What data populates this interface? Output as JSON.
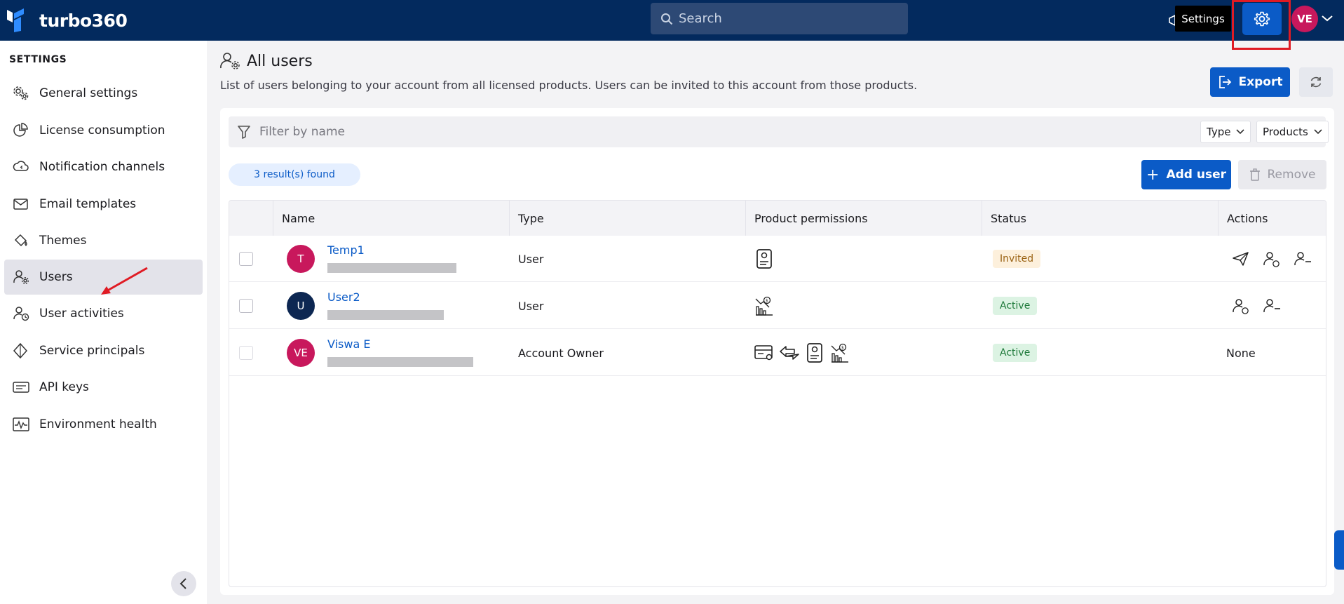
{
  "header": {
    "logo_text": "turbo360",
    "search_placeholder": "Search",
    "tooltip": "Settings",
    "avatar_initials": "VE"
  },
  "sidebar": {
    "heading": "SETTINGS",
    "items": [
      {
        "label": "General settings",
        "icon": "gears-icon"
      },
      {
        "label": "License consumption",
        "icon": "pie-chart-icon"
      },
      {
        "label": "Notification channels",
        "icon": "cloud-bell-icon"
      },
      {
        "label": "Email templates",
        "icon": "envelope-icon"
      },
      {
        "label": "Themes",
        "icon": "paint-bucket-icon"
      },
      {
        "label": "Users",
        "icon": "user-gear-icon",
        "active": true
      },
      {
        "label": "User activities",
        "icon": "user-clock-icon"
      },
      {
        "label": "Service principals",
        "icon": "diamond-icon"
      },
      {
        "label": "API keys",
        "icon": "api-key-icon"
      },
      {
        "label": "Environment health",
        "icon": "pulse-icon"
      }
    ]
  },
  "page": {
    "title": "All users",
    "description": "List of users belonging to your account from all licensed products. Users can be invited to this account from those products.",
    "export_label": "Export"
  },
  "filters": {
    "placeholder": "Filter by name",
    "type_label": "Type",
    "products_label": "Products"
  },
  "results": {
    "count_text": "3 result(s) found",
    "add_user_label": "Add user",
    "remove_label": "Remove"
  },
  "table": {
    "columns": [
      "Name",
      "Type",
      "Product permissions",
      "Status",
      "Actions"
    ],
    "rows": [
      {
        "initials": "T",
        "avatar_color": "#c8185c",
        "name": "Temp1",
        "type": "User",
        "status": "Invited",
        "actions_text": ""
      },
      {
        "initials": "U",
        "avatar_color": "#0d2752",
        "name": "User2",
        "type": "User",
        "status": "Active",
        "actions_text": ""
      },
      {
        "initials": "VE",
        "avatar_color": "#c8185c",
        "name": "Viswa E",
        "type": "Account Owner",
        "status": "Active",
        "actions_text": "None"
      }
    ]
  },
  "colors": {
    "header_bg": "#032a5e",
    "accent": "#0b5bc7",
    "annotation": "#e01b24"
  }
}
